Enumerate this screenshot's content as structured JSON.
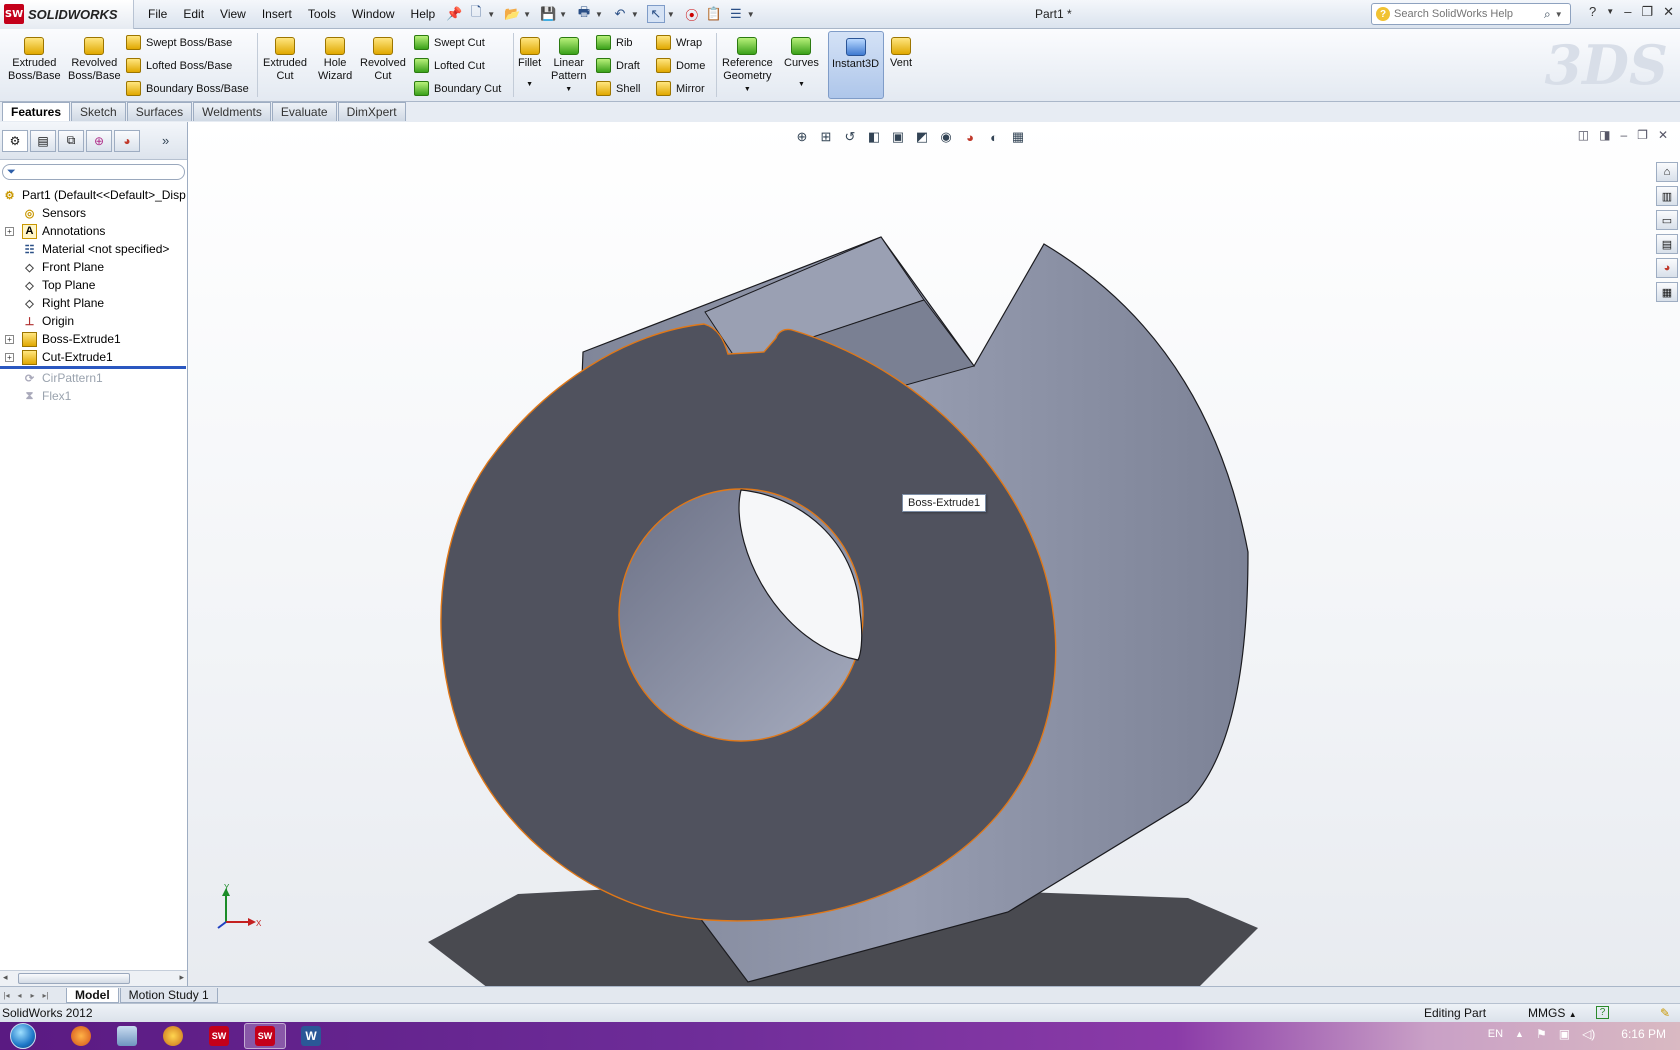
{
  "app": {
    "brand": "SOLIDWORKS",
    "document_title": "Part1 *"
  },
  "menu": [
    "File",
    "Edit",
    "View",
    "Insert",
    "Tools",
    "Window",
    "Help"
  ],
  "search": {
    "placeholder": "Search SolidWorks Help"
  },
  "command_manager": {
    "extruded_boss": "Extruded\nBoss/Base",
    "revolved_boss": "Revolved\nBoss/Base",
    "swept_boss": "Swept Boss/Base",
    "lofted_boss": "Lofted Boss/Base",
    "boundary_boss": "Boundary Boss/Base",
    "extruded_cut": "Extruded\nCut",
    "hole_wizard": "Hole\nWizard",
    "revolved_cut": "Revolved\nCut",
    "swept_cut": "Swept Cut",
    "lofted_cut": "Lofted Cut",
    "boundary_cut": "Boundary Cut",
    "fillet": "Fillet",
    "linear_pattern": "Linear\nPattern",
    "rib": "Rib",
    "draft": "Draft",
    "shell": "Shell",
    "wrap": "Wrap",
    "dome": "Dome",
    "mirror": "Mirror",
    "reference_geometry": "Reference\nGeometry",
    "curves": "Curves",
    "instant3d": "Instant3D",
    "vent": "Vent"
  },
  "tabs": [
    "Features",
    "Sketch",
    "Surfaces",
    "Weldments",
    "Evaluate",
    "DimXpert"
  ],
  "feature_tree": {
    "root": "Part1  (Default<<Default>_Disp",
    "items": [
      {
        "label": "Sensors",
        "expandable": false
      },
      {
        "label": "Annotations",
        "expandable": true
      },
      {
        "label": "Material <not specified>",
        "expandable": false
      },
      {
        "label": "Front Plane",
        "expandable": false
      },
      {
        "label": "Top Plane",
        "expandable": false
      },
      {
        "label": "Right Plane",
        "expandable": false
      },
      {
        "label": "Origin",
        "expandable": false
      },
      {
        "label": "Boss-Extrude1",
        "expandable": true
      },
      {
        "label": "Cut-Extrude1",
        "expandable": true
      }
    ],
    "suppressed": [
      {
        "label": "CirPattern1"
      },
      {
        "label": "Flex1"
      }
    ]
  },
  "viewport": {
    "tooltip": "Boss-Extrude1",
    "triad_x": "X",
    "triad_y": "Y"
  },
  "bottom_tabs": [
    "Model",
    "Motion Study 1"
  ],
  "status": {
    "left": "SolidWorks 2012",
    "mode": "Editing Part",
    "units": "MMGS"
  },
  "taskbar": {
    "language": "EN",
    "time": "6:16 PM"
  },
  "colors": {
    "part_face": "#50525e",
    "part_side": "#8e94a8",
    "selection_edge": "#e07818",
    "taskbar": "#6d2c98"
  }
}
